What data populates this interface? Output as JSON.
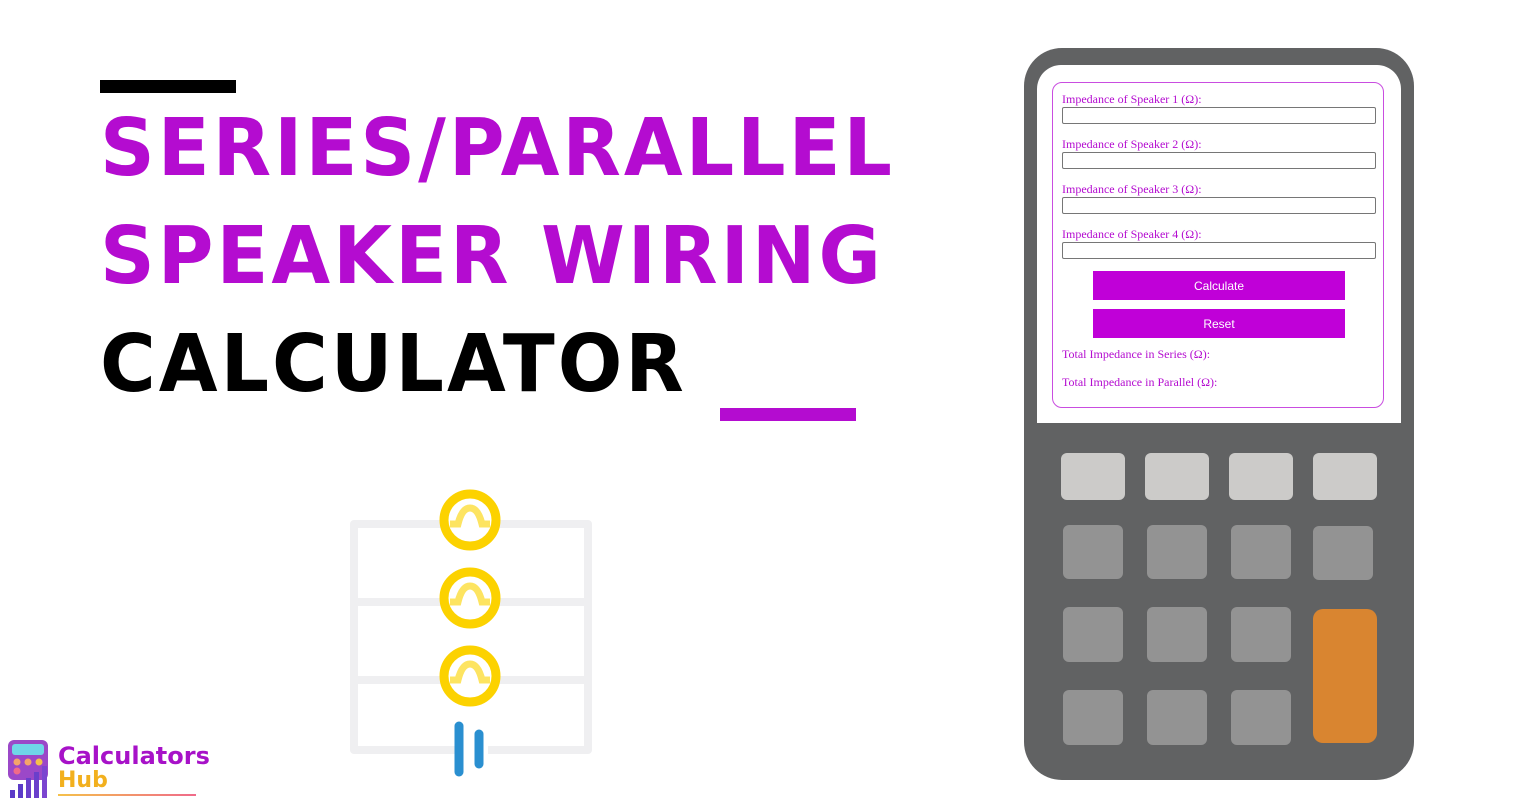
{
  "headline": {
    "line1": "Series/Parallel",
    "line2": "Speaker Wiring",
    "line3": "Calculator"
  },
  "colors": {
    "accent": "#b40cd0",
    "button": "#c000d8",
    "device_body": "#616263",
    "key_light": "#cccbc9",
    "key_mid": "#939393",
    "key_orange": "#d98530",
    "speaker_yellow": "#fcd200",
    "battery_blue": "#2a8fd0"
  },
  "form": {
    "fields": [
      {
        "label": "Impedance of Speaker 1 (Ω):",
        "value": "",
        "placeholder": ""
      },
      {
        "label": "Impedance of Speaker 2 (Ω):",
        "value": "",
        "placeholder": ""
      },
      {
        "label": "Impedance of Speaker 3 (Ω):",
        "value": "",
        "placeholder": ""
      },
      {
        "label": "Impedance of Speaker 4 (Ω):",
        "value": "",
        "placeholder": ""
      }
    ],
    "calculate_label": "Calculate",
    "reset_label": "Reset",
    "results": {
      "series_label": "Total Impedance in Series (Ω):",
      "series_value": "",
      "parallel_label": "Total Impedance in Parallel (Ω):",
      "parallel_value": ""
    }
  },
  "logo": {
    "line1": "Calculators",
    "line2": "Hub"
  },
  "illustration": {
    "icon": "speaker-circuit-icon",
    "speaker_count": 3
  },
  "device": {
    "icon": "calculator-icon",
    "key_rows": 4,
    "key_cols": 4
  }
}
